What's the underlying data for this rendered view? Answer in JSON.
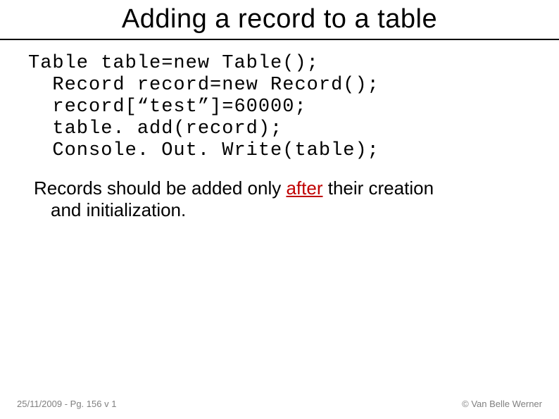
{
  "title": "Adding a record to a table",
  "code": {
    "l1": "Table table=new Table();",
    "l2": "Record record=new Record();",
    "l3": "record[“test”]=60000;",
    "l4": "table. add(record);",
    "l5": "Console. Out. Write(table);"
  },
  "body": {
    "line1_pre": "Records should be added only ",
    "emph": "after",
    "line1_post": " their creation",
    "line2": "and initialization."
  },
  "footer": {
    "left": "25/11/2009 - Pg. 156 v 1",
    "right": "© Van Belle Werner"
  }
}
